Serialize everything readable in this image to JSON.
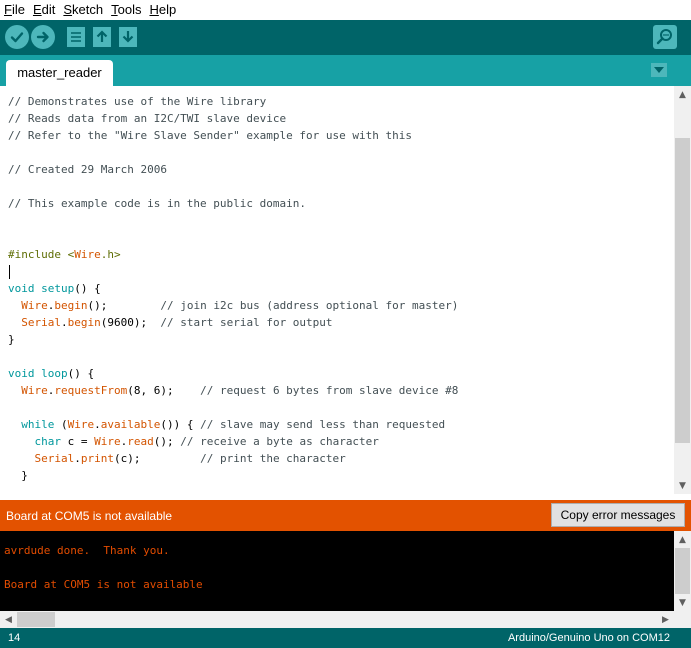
{
  "menu": {
    "items": [
      {
        "label": "File"
      },
      {
        "label": "Edit"
      },
      {
        "label": "Sketch"
      },
      {
        "label": "Tools"
      },
      {
        "label": "Help"
      }
    ]
  },
  "toolbar": {
    "buttons": [
      {
        "icon": "verify-check-icon"
      },
      {
        "icon": "upload-arrow-icon"
      },
      {
        "icon": "new-sketch-icon"
      },
      {
        "icon": "open-sketch-icon"
      },
      {
        "icon": "save-sketch-icon"
      }
    ],
    "serial_monitor_icon": "serial-monitor-magnifier-icon"
  },
  "tabs": [
    {
      "label": "master_reader"
    }
  ],
  "editor": {
    "lines": [
      "// Demonstrates use of the Wire library",
      "// Reads data from an I2C/TWI slave device",
      "// Refer to the \"Wire Slave Sender\" example for use with this",
      "",
      "// Created 29 March 2006",
      "",
      "// This example code is in the public domain.",
      "",
      "",
      "#include <Wire.h>",
      "",
      "void setup() {",
      "  Wire.begin();        // join i2c bus (address optional for master)",
      "  Serial.begin(9600);  // start serial for output",
      "}",
      "",
      "void loop() {",
      "  Wire.requestFrom(8, 6);    // request 6 bytes from slave device #8",
      "",
      "  while (Wire.available()) { // slave may send less than requested",
      "    char c = Wire.read(); // receive a byte as character",
      "    Serial.print(c);         // print the character",
      "  }"
    ]
  },
  "status": {
    "message": "Board at COM5 is not available",
    "copy_button_label": "Copy error messages"
  },
  "console": {
    "lines": [
      "avrdude done.  Thank you.",
      "",
      "Board at COM5 is not available"
    ]
  },
  "footer": {
    "line_number": "14",
    "board": "Arduino/Genuino Uno on COM12"
  },
  "colors": {
    "toolbar_bg": "#006468",
    "tabbar_bg": "#17a1a5",
    "status_bg": "#e35200",
    "console_text": "#e34c00"
  }
}
